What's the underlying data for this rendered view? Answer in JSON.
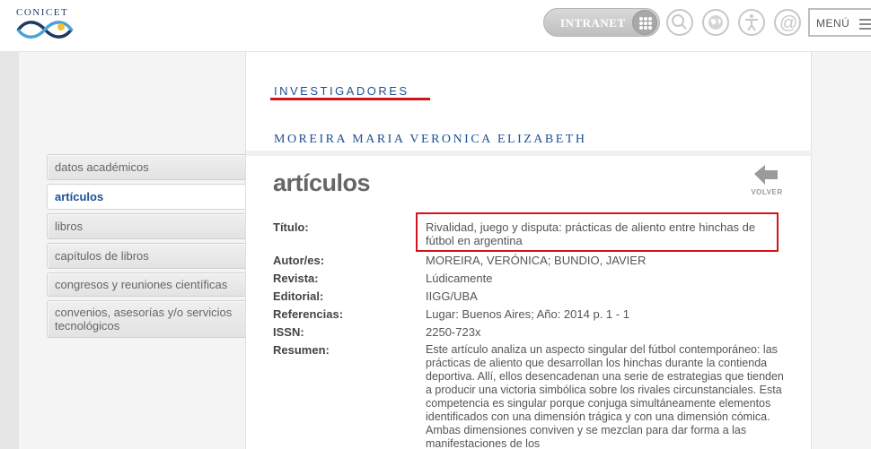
{
  "header": {
    "logo_text": "CONICET",
    "intranet_label": "INTRANET",
    "icons": [
      "search-icon",
      "globe-icon",
      "accessibility-icon",
      "at-icon"
    ],
    "menu_label": "MENÚ"
  },
  "sidebar": {
    "items": [
      {
        "label": "datos académicos",
        "active": false
      },
      {
        "label": "artículos",
        "active": true
      },
      {
        "label": "libros",
        "active": false
      },
      {
        "label": "capítulos de libros",
        "active": false
      },
      {
        "label": "congresos y reuniones científicas",
        "active": false
      },
      {
        "label": "convenios, asesorías y/o servicios tecnológicos",
        "active": false
      }
    ]
  },
  "main": {
    "section_title": "INVESTIGADORES",
    "researcher_name": "MOREIRA MARIA VERONICA ELIZABETH",
    "heading": "artículos",
    "back_label": "VOLVER",
    "fields": {
      "titulo_label": "Título:",
      "titulo_value": "Rivalidad, juego y disputa: prácticas de aliento entre hinchas de fútbol en argentina",
      "autores_label": "Autor/es:",
      "autores_value": "MOREIRA, VERÓNICA; BUNDIO, JAVIER",
      "revista_label": "Revista:",
      "revista_value": "Lúdicamente",
      "editorial_label": "Editorial:",
      "editorial_value": "IIGG/UBA",
      "referencias_label": "Referencias:",
      "referencias_value": "Lugar: Buenos Aires; Año: 2014 p. 1 - 1",
      "issn_label": "ISSN:",
      "issn_value": "2250-723x",
      "resumen_label": "Resumen:",
      "resumen_value": "Este artículo analiza un aspecto singular del fútbol contemporáneo: las prácticas de aliento que desarrollan los hinchas durante la contienda deportiva. Allí, ellos desencadenan una serie de estrategias que tienden a producir una victoria simbólica sobre los rivales circunstanciales. Esta competencia es singular porque conjuga simultáneamente elementos identificados con una dimensión trágica y con una dimensión cómica. Ambas dimensiones conviven y se mezclan para dar forma a las manifestaciones de los"
    }
  },
  "colors": {
    "accent_blue": "#1d4f91",
    "highlight_red": "#d0141a",
    "logo_blue": "#4aa3d8"
  }
}
